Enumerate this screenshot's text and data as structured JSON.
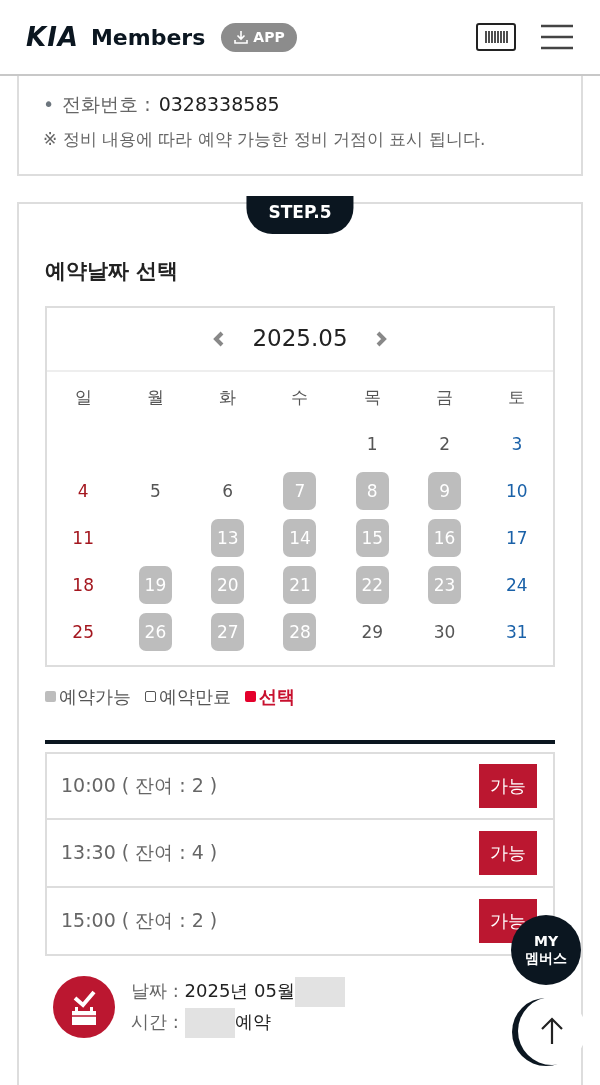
{
  "header": {
    "logo": "KIA",
    "brand": "Members",
    "app_button": "APP"
  },
  "info_card": {
    "bullet": "•",
    "phone_label": "전화번호 :",
    "phone": "0328338585",
    "note": "※ 정비 내용에 따라 예약 가능한 정비 거점이 표시 됩니다."
  },
  "step": {
    "badge": "STEP.5",
    "title": "예약날짜 선택"
  },
  "calendar": {
    "month": "2025.05",
    "weekdays": [
      "일",
      "월",
      "화",
      "수",
      "목",
      "금",
      "토"
    ],
    "weeks": [
      [
        {
          "kind": "empty"
        },
        {
          "kind": "empty"
        },
        {
          "kind": "empty"
        },
        {
          "kind": "empty"
        },
        {
          "kind": "day",
          "day": "1",
          "available": false
        },
        {
          "kind": "day",
          "day": "2",
          "available": false
        },
        {
          "kind": "day",
          "day": "3",
          "available": false
        }
      ],
      [
        {
          "kind": "day",
          "day": "4",
          "available": false
        },
        {
          "kind": "day",
          "day": "5",
          "available": false
        },
        {
          "kind": "day",
          "day": "6",
          "available": false
        },
        {
          "kind": "day",
          "day": "7",
          "available": true
        },
        {
          "kind": "day",
          "day": "8",
          "available": true
        },
        {
          "kind": "day",
          "day": "9",
          "available": true
        },
        {
          "kind": "day",
          "day": "10",
          "available": false
        }
      ],
      [
        {
          "kind": "day",
          "day": "11",
          "available": false
        },
        {
          "kind": "empty"
        },
        {
          "kind": "day",
          "day": "13",
          "available": true
        },
        {
          "kind": "day",
          "day": "14",
          "available": true
        },
        {
          "kind": "day",
          "day": "15",
          "available": true
        },
        {
          "kind": "day",
          "day": "16",
          "available": true
        },
        {
          "kind": "day",
          "day": "17",
          "available": false
        }
      ],
      [
        {
          "kind": "day",
          "day": "18",
          "available": false
        },
        {
          "kind": "day",
          "day": "19",
          "available": true
        },
        {
          "kind": "day",
          "day": "20",
          "available": true
        },
        {
          "kind": "day",
          "day": "21",
          "available": true
        },
        {
          "kind": "day",
          "day": "22",
          "available": true
        },
        {
          "kind": "day",
          "day": "23",
          "available": true
        },
        {
          "kind": "day",
          "day": "24",
          "available": false
        }
      ],
      [
        {
          "kind": "day",
          "day": "25",
          "available": false
        },
        {
          "kind": "day",
          "day": "26",
          "available": true
        },
        {
          "kind": "day",
          "day": "27",
          "available": true
        },
        {
          "kind": "day",
          "day": "28",
          "available": true
        },
        {
          "kind": "day",
          "day": "29",
          "available": false
        },
        {
          "kind": "day",
          "day": "30",
          "available": false
        },
        {
          "kind": "day",
          "day": "31",
          "available": false
        }
      ]
    ]
  },
  "legend": [
    {
      "kind": "available",
      "label": "예약가능"
    },
    {
      "kind": "closed",
      "label": "예약만료"
    },
    {
      "kind": "selected",
      "label": "선택"
    }
  ],
  "time_slots": [
    {
      "time": "10:00 ( 잔여 : 2 )",
      "button": "가능"
    },
    {
      "time": "13:30 ( 잔여 : 4 )",
      "button": "가능"
    },
    {
      "time": "15:00 ( 잔여 : 2 )",
      "button": "가능"
    }
  ],
  "summary": {
    "date_label": "날짜 :",
    "date_value": "2025년 05월",
    "time_label": "시간 :",
    "time_value": "예약"
  },
  "floating": {
    "members_button": [
      "MY",
      "멤버스"
    ]
  }
}
